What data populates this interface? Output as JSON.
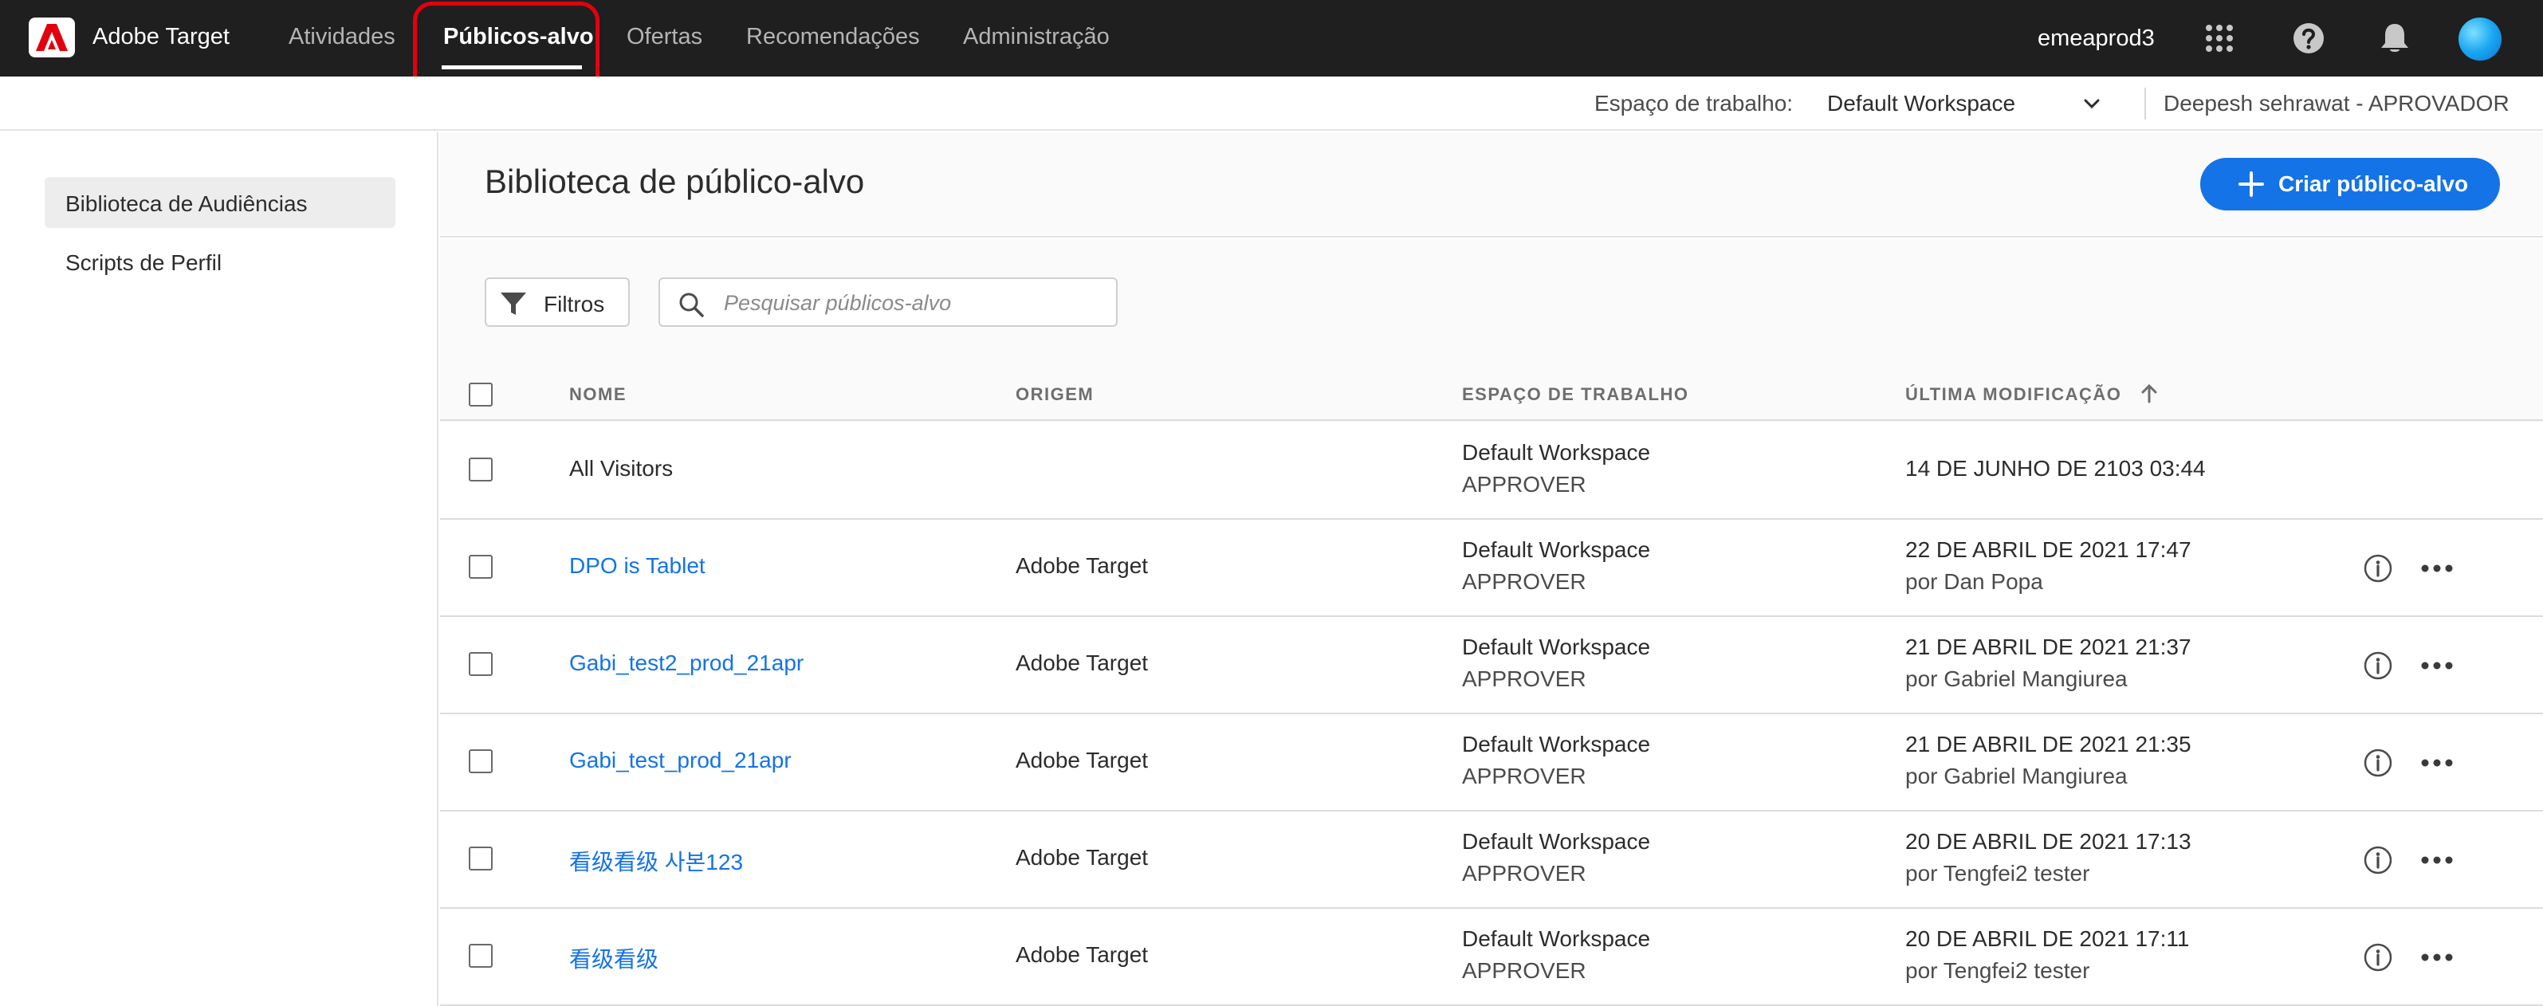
{
  "nav": {
    "brand": "Adobe Target",
    "links": [
      "Atividades",
      "Públicos-alvo",
      "Ofertas",
      "Recomendações",
      "Administração"
    ],
    "active_link": "Públicos-alvo",
    "org": "emeaprod3",
    "icons": [
      "apps-grid-icon",
      "help-icon",
      "bell-icon"
    ]
  },
  "workspace_bar": {
    "label": "Espaço de trabalho:",
    "value": "Default Workspace",
    "user": "Deepesh sehrawat - APROVADOR"
  },
  "sidebar": {
    "items": [
      "Biblioteca de Audiências",
      "Scripts de Perfil"
    ],
    "active_item": "Biblioteca de Audiências"
  },
  "page": {
    "title": "Biblioteca de público-alvo",
    "create_button": "Criar público-alvo"
  },
  "toolbar": {
    "filter_label": "Filtros",
    "search_placeholder": "Pesquisar públicos-alvo",
    "search_value": ""
  },
  "table": {
    "columns": [
      "NOME",
      "ORIGEM",
      "ESPAÇO DE TRABALHO",
      "ÚLTIMA MODIFICAÇÃO"
    ],
    "sort_column": "ÚLTIMA MODIFICAÇÃO",
    "sort_direction": "ascending",
    "rows": [
      {
        "name": "All Visitors",
        "origin": "",
        "workspace": "Default Workspace",
        "role": "APPROVER",
        "modified": "14 DE JUNHO DE 2103 03:44",
        "modified_by": ""
      },
      {
        "name": "DPO is Tablet",
        "origin": "Adobe Target",
        "workspace": "Default Workspace",
        "role": "APPROVER",
        "modified": "22 DE ABRIL DE 2021 17:47",
        "modified_by": "por Dan Popa"
      },
      {
        "name": "Gabi_test2_prod_21apr",
        "origin": "Adobe Target",
        "workspace": "Default Workspace",
        "role": "APPROVER",
        "modified": "21 DE ABRIL DE 2021 21:37",
        "modified_by": "por Gabriel Mangiurea"
      },
      {
        "name": "Gabi_test_prod_21apr",
        "origin": "Adobe Target",
        "workspace": "Default Workspace",
        "role": "APPROVER",
        "modified": "21 DE ABRIL DE 2021 21:35",
        "modified_by": "por Gabriel Mangiurea"
      },
      {
        "name": "看级看级 사본123",
        "origin": "Adobe Target",
        "workspace": "Default Workspace",
        "role": "APPROVER",
        "modified": "20 DE ABRIL DE 2021 17:13",
        "modified_by": "por Tengfei2 tester"
      },
      {
        "name": "看级看级",
        "origin": "Adobe Target",
        "workspace": "Default Workspace",
        "role": "APPROVER",
        "modified": "20 DE ABRIL DE 2021 17:11",
        "modified_by": "por Tengfei2 tester"
      }
    ]
  },
  "colors": {
    "topnav_bg": "#1f1f1f",
    "accent_blue": "#1473e6",
    "highlight_red": "#e3000e"
  }
}
